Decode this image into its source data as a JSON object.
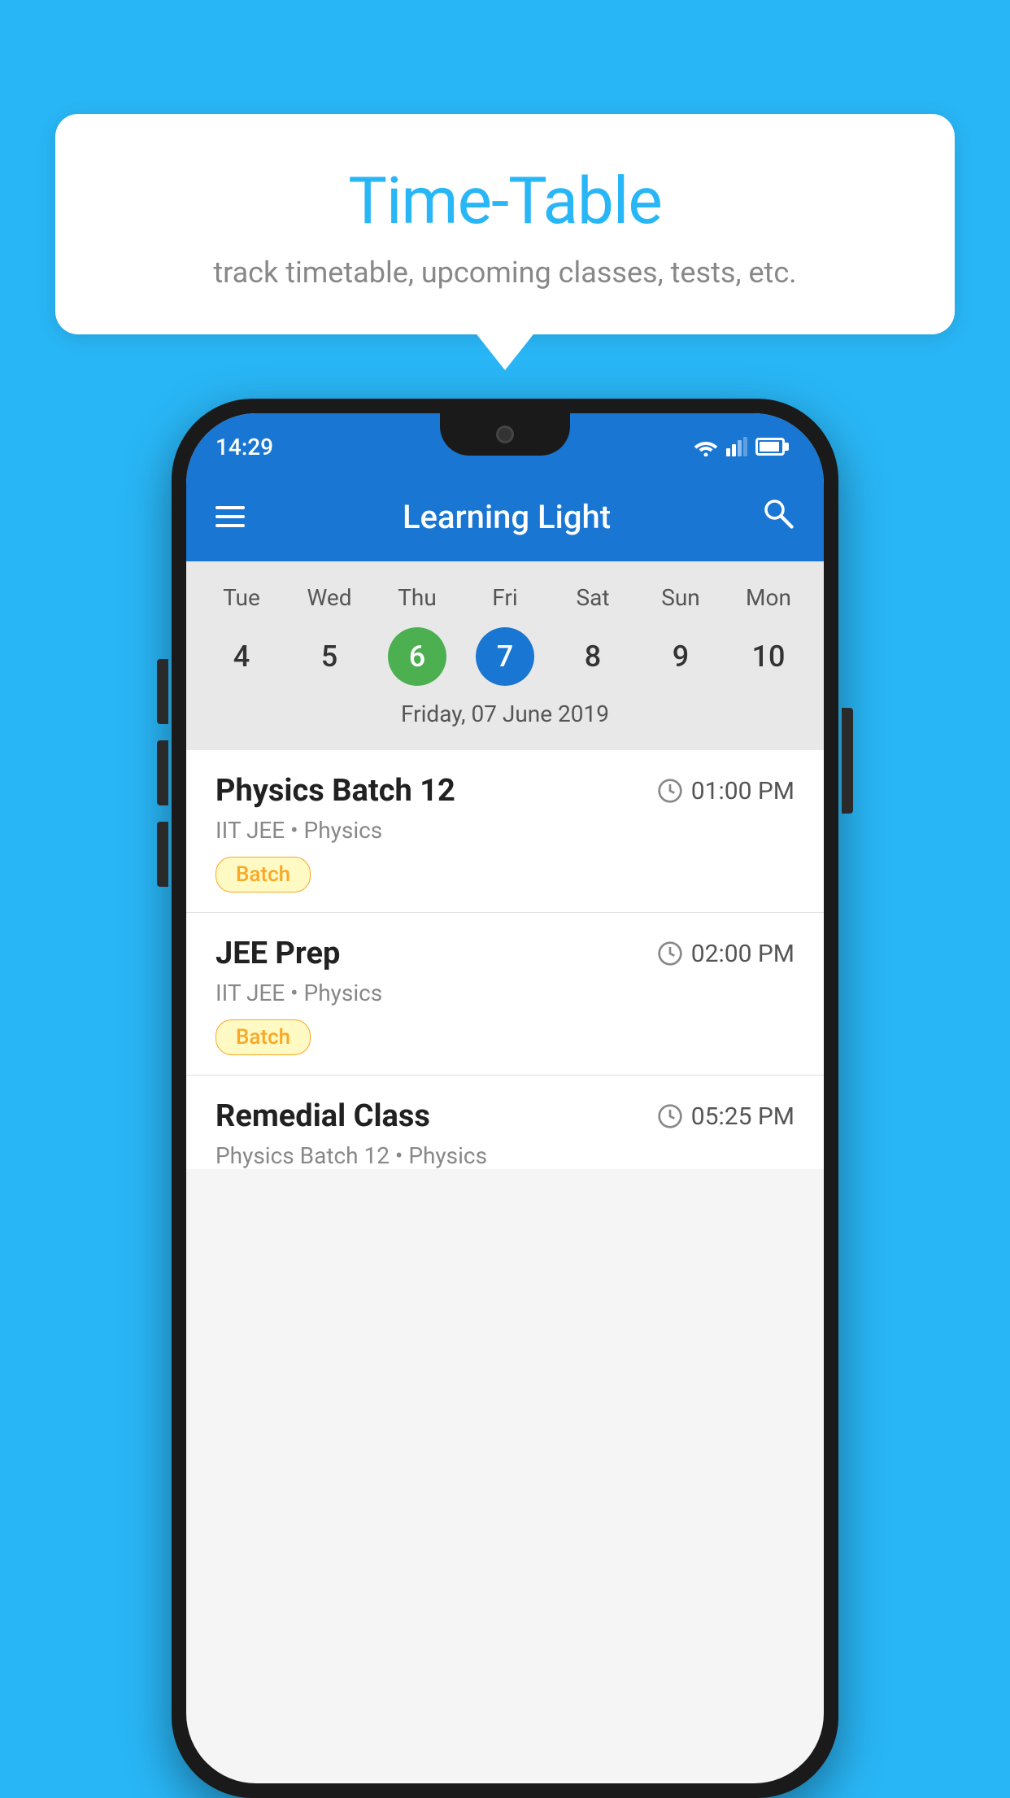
{
  "background_color": "#29B6F6",
  "tooltip": {
    "title": "Time-Table",
    "subtitle": "track timetable, upcoming classes, tests, etc."
  },
  "phone": {
    "status_bar": {
      "time": "14:29"
    },
    "app_bar": {
      "title": "Learning Light"
    },
    "calendar": {
      "days": [
        "Tue",
        "Wed",
        "Thu",
        "Fri",
        "Sat",
        "Sun",
        "Mon"
      ],
      "dates": [
        "4",
        "5",
        "6",
        "7",
        "8",
        "9",
        "10"
      ],
      "today_index": 2,
      "selected_index": 3,
      "selected_label": "Friday, 07 June 2019"
    },
    "schedule": [
      {
        "title": "Physics Batch 12",
        "time": "01:00 PM",
        "subtitle": "IIT JEE • Physics",
        "badge": "Batch"
      },
      {
        "title": "JEE Prep",
        "time": "02:00 PM",
        "subtitle": "IIT JEE • Physics",
        "badge": "Batch"
      },
      {
        "title": "Remedial Class",
        "time": "05:25 PM",
        "subtitle": "Physics Batch 12 • Physics",
        "badge": null
      }
    ]
  }
}
